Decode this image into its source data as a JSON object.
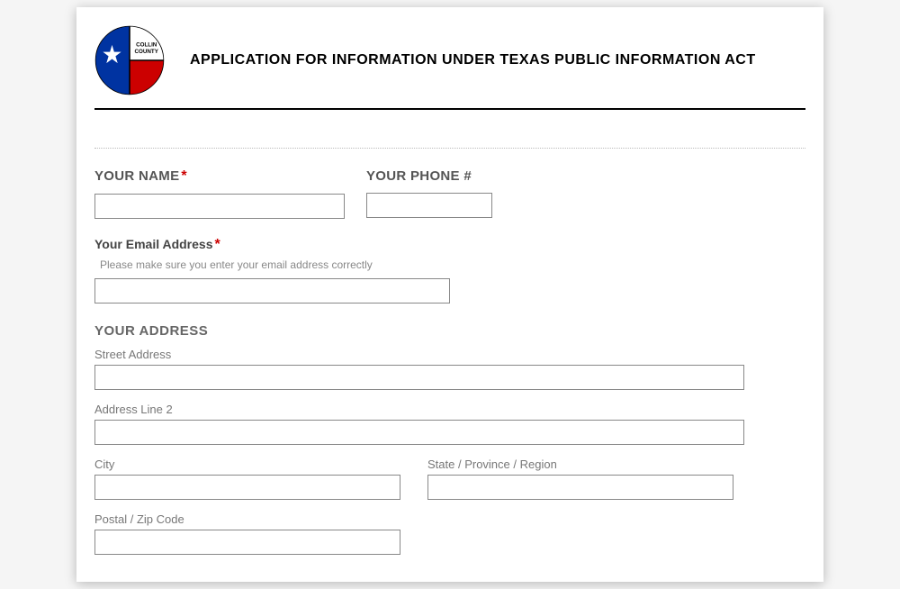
{
  "header": {
    "title": "APPLICATION FOR INFORMATION UNDER TEXAS PUBLIC INFORMATION ACT",
    "logo_text_top": "COLLIN",
    "logo_text_bot": "COUNTY"
  },
  "form": {
    "name": {
      "label": "YOUR NAME",
      "value": ""
    },
    "phone": {
      "label": "YOUR PHONE #",
      "value": ""
    },
    "email": {
      "label": "Your Email Address",
      "helper": "Please make sure you enter your email address correctly",
      "value": ""
    },
    "address": {
      "section_label": "YOUR ADDRESS",
      "street": {
        "label": "Street Address",
        "value": ""
      },
      "line2": {
        "label": "Address Line 2",
        "value": ""
      },
      "city": {
        "label": "City",
        "value": ""
      },
      "state": {
        "label": "State / Province / Region",
        "value": ""
      },
      "postal": {
        "label": "Postal / Zip Code",
        "value": ""
      }
    }
  },
  "required_mark": "*"
}
